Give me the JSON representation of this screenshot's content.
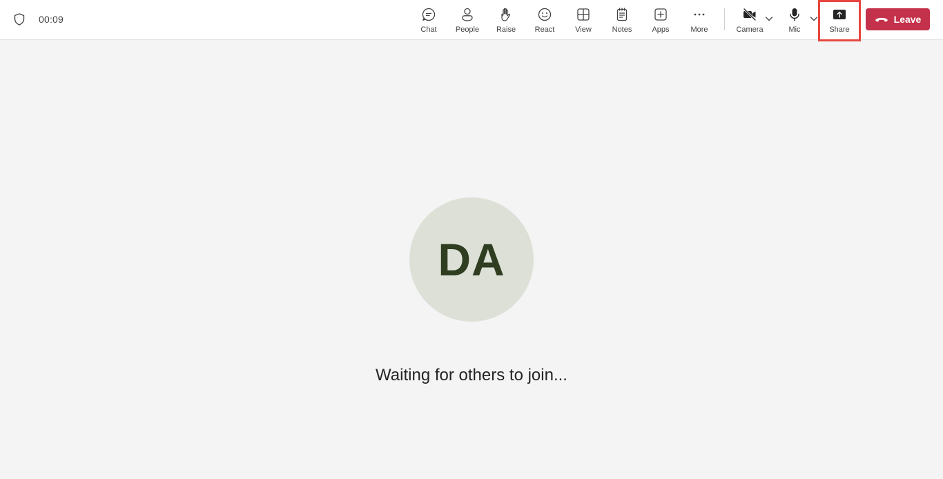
{
  "meeting": {
    "timer": "00:09",
    "avatar_initials": "DA",
    "status_text": "Waiting for others to join..."
  },
  "toolbar": {
    "chat_label": "Chat",
    "people_label": "People",
    "raise_label": "Raise",
    "react_label": "React",
    "view_label": "View",
    "notes_label": "Notes",
    "apps_label": "Apps",
    "more_label": "More",
    "camera_label": "Camera",
    "mic_label": "Mic",
    "share_label": "Share",
    "leave_label": "Leave"
  },
  "icons": {
    "shield": "shield-icon",
    "chat": "chat-icon",
    "people": "people-icon",
    "raise": "raise-hand-icon",
    "react": "smiley-icon",
    "view": "grid-icon",
    "notes": "notes-icon",
    "apps": "plus-square-icon",
    "more": "ellipsis-icon",
    "camera": "camera-off-icon",
    "mic": "mic-icon",
    "share": "share-tray-icon",
    "leave": "phone-hangup-icon"
  },
  "colors": {
    "leave_button": "#c4314b",
    "highlight_border": "#e8453c",
    "avatar_bg": "#dce0d6",
    "avatar_text": "#2f3d21",
    "stage_bg": "#f4f4f4"
  }
}
